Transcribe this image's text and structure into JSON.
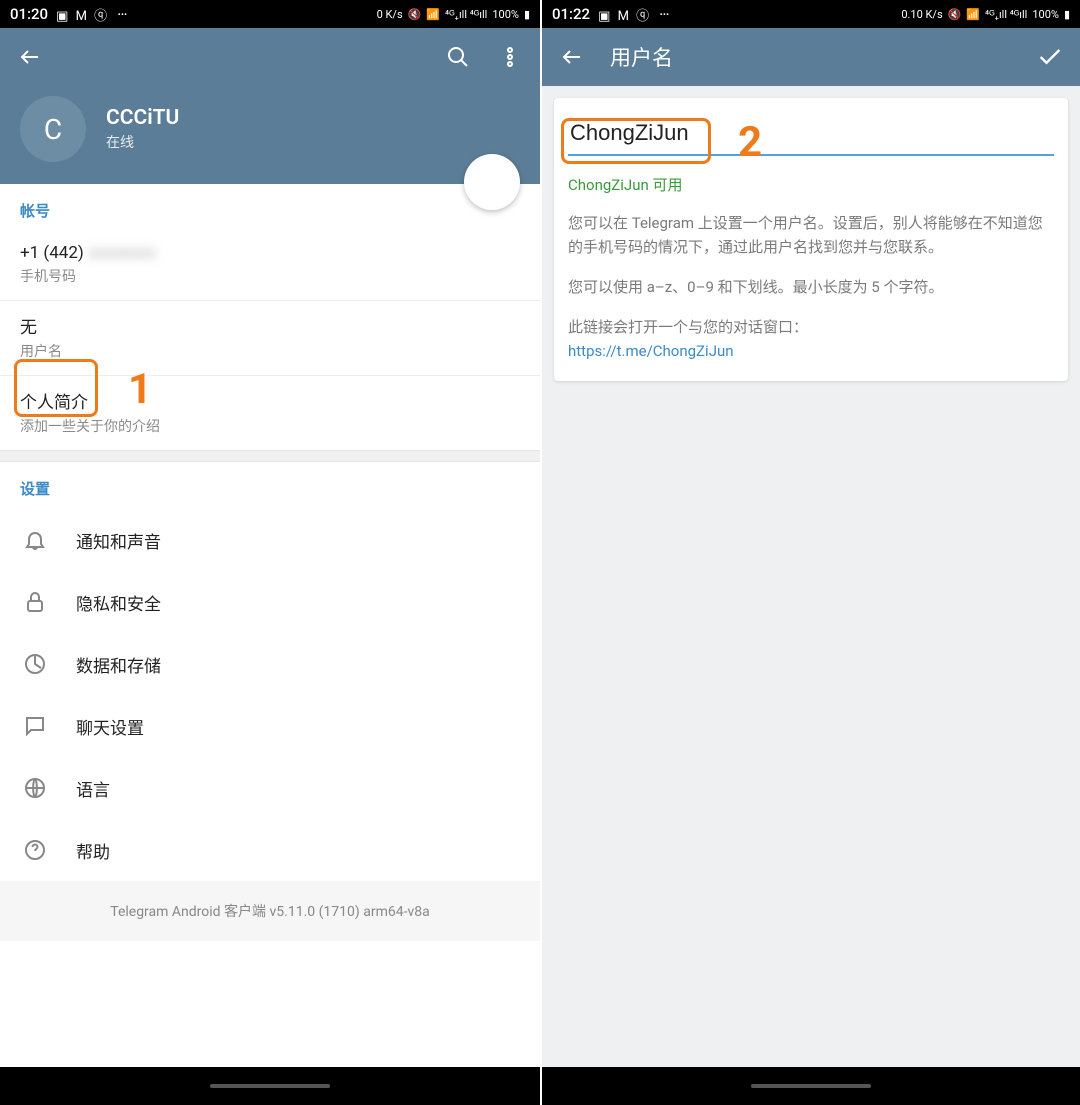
{
  "left": {
    "status": {
      "time": "01:20",
      "speed": "0 K/s",
      "battery": "100%"
    },
    "profile": {
      "avatar_initial": "C",
      "name": "CCCiTU",
      "status": "在线"
    },
    "sections": {
      "account_title": "帐号",
      "phone_value": "+1 (442)",
      "phone_label": "手机号码",
      "username_value": "无",
      "username_label": "用户名",
      "bio_value": "个人简介",
      "bio_label": "添加一些关于你的介绍",
      "settings_title": "设置"
    },
    "settings": [
      {
        "label": "通知和声音",
        "icon": "bell"
      },
      {
        "label": "隐私和安全",
        "icon": "lock"
      },
      {
        "label": "数据和存储",
        "icon": "data"
      },
      {
        "label": "聊天设置",
        "icon": "chat"
      },
      {
        "label": "语言",
        "icon": "globe"
      },
      {
        "label": "帮助",
        "icon": "help"
      }
    ],
    "version": "Telegram Android 客户端 v5.11.0 (1710) arm64-v8a",
    "callout": "1"
  },
  "right": {
    "status": {
      "time": "01:22",
      "speed": "0.10 K/s",
      "battery": "100%"
    },
    "appbar_title": "用户名",
    "username_value": "ChongZiJun",
    "available_text": "ChongZiJun 可用",
    "help1": "您可以在 Telegram 上设置一个用户名。设置后，别人将能够在不知道您的手机号码的情况下，通过此用户名找到您并与您联系。",
    "help2": "您可以使用 a–z、0–9 和下划线。最小长度为 5 个字符。",
    "help3": "此链接会打开一个与您的对话窗口：",
    "link": "https://t.me/ChongZiJun",
    "callout": "2"
  }
}
